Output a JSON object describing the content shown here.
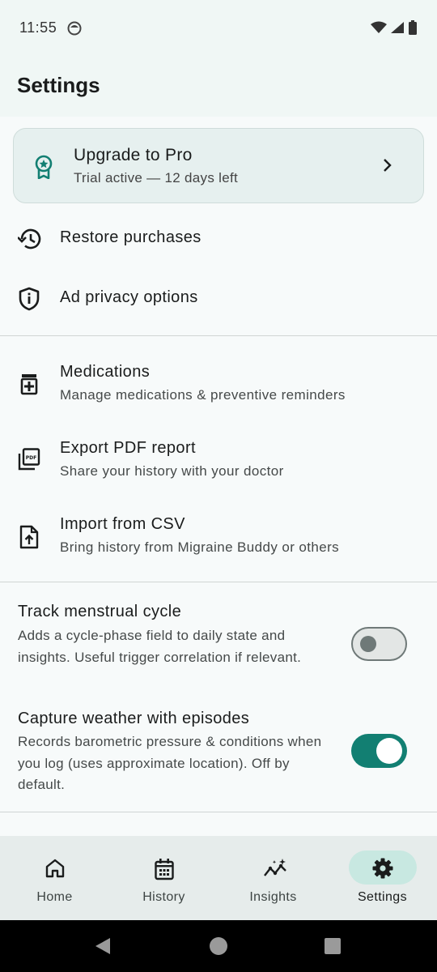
{
  "status_bar": {
    "time": "11:55"
  },
  "header": {
    "title": "Settings"
  },
  "pro_card": {
    "title": "Upgrade to Pro",
    "subtitle": "Trial active — 12 days left"
  },
  "account": {
    "restore_label": "Restore purchases",
    "ad_privacy_label": "Ad privacy options"
  },
  "data_rows": [
    {
      "title": "Medications",
      "subtitle": "Manage medications & preventive reminders"
    },
    {
      "title": "Export PDF report",
      "subtitle": "Share your history with your doctor"
    },
    {
      "title": "Import from CSV",
      "subtitle": "Bring history from Migraine Buddy or others"
    }
  ],
  "toggles": [
    {
      "title": "Track menstrual cycle",
      "description": "Adds a cycle-phase field to daily state and insights. Useful trigger correlation if relevant.",
      "on": false
    },
    {
      "title": "Capture weather with episodes",
      "description": "Records barometric pressure & conditions when you log (uses approximate location). Off by default.",
      "on": true
    }
  ],
  "bottom_nav": [
    {
      "label": "Home",
      "icon": "home-icon",
      "active": false
    },
    {
      "label": "History",
      "icon": "calendar-icon",
      "active": false
    },
    {
      "label": "Insights",
      "icon": "insights-icon",
      "active": false
    },
    {
      "label": "Settings",
      "icon": "gear-icon",
      "active": true
    }
  ],
  "colors": {
    "accent": "#127f72",
    "card_bg": "#e6f0ef",
    "nav_active_pill": "#c8e8e1"
  }
}
